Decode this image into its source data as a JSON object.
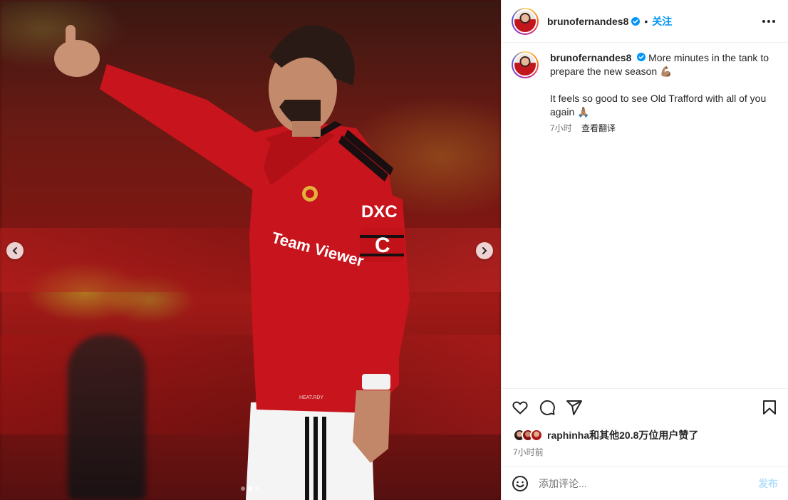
{
  "author": {
    "username": "brunofernandes8",
    "follow_label": "关注"
  },
  "caption": {
    "username": "brunofernandes8",
    "line1": "More minutes in the tank to prepare the new season 💪🏽",
    "line2": "It feels so good to see Old Trafford with all of you again 🙏🏽",
    "time": "7小时",
    "translate_label": "查看翻译"
  },
  "media": {
    "jersey_sponsor": "Team Viewer",
    "sleeve_text": "DXC",
    "armband_letter": "C",
    "kit_label": "HEAT.RDY",
    "dots": {
      "count": 3,
      "active_index": 1
    }
  },
  "likes": {
    "text": "raphinha和其他20.8万位用户赞了"
  },
  "post_time": "7小时前",
  "comment": {
    "placeholder": "添加评论...",
    "post_label": "发布"
  },
  "colors": {
    "accent": "#0095f6",
    "post_disabled": "#b2dffc",
    "text": "#262626",
    "secondary": "#737373"
  },
  "icons": [
    "chevron-left-icon",
    "chevron-right-icon",
    "verified-icon",
    "more-icon",
    "heart-icon",
    "comment-icon",
    "share-icon",
    "bookmark-icon",
    "emoji-icon"
  ]
}
